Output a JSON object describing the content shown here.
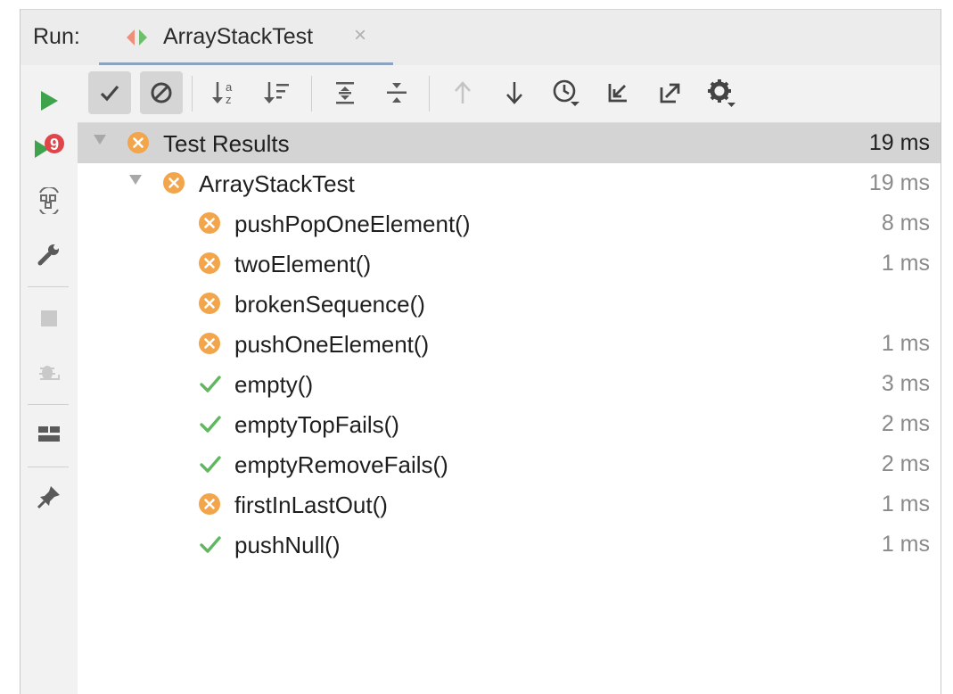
{
  "run": {
    "label": "Run:",
    "tab_title": "ArrayStackTest",
    "tab_close": "×"
  },
  "left_toolbar": [
    {
      "name": "rerun-icon"
    },
    {
      "name": "rerun-failed-icon",
      "badge": "9"
    },
    {
      "name": "toggle-auto-test-icon"
    },
    {
      "name": "edit-configuration-icon"
    },
    {
      "name": "stop-icon"
    },
    {
      "name": "debug-icon"
    },
    {
      "name": "layout-icon"
    },
    {
      "name": "pin-icon"
    }
  ],
  "top_toolbar": [
    {
      "name": "show-passed-icon",
      "active": true
    },
    {
      "name": "show-ignored-icon",
      "active": true
    },
    {
      "name": "sort-alphabetically-icon"
    },
    {
      "name": "sort-by-duration-icon"
    },
    {
      "name": "expand-all-icon"
    },
    {
      "name": "collapse-all-icon"
    },
    {
      "name": "previous-failed-icon",
      "disabled": true
    },
    {
      "name": "next-failed-icon"
    },
    {
      "name": "test-history-icon"
    },
    {
      "name": "import-tests-icon"
    },
    {
      "name": "export-tests-icon"
    },
    {
      "name": "settings-icon"
    }
  ],
  "tree": [
    {
      "label": "Test Results",
      "time": "19 ms",
      "status": "fail",
      "level": 0,
      "expanded": true,
      "selected": true
    },
    {
      "label": "ArrayStackTest",
      "time": "19 ms",
      "status": "fail",
      "level": 1,
      "expanded": true
    },
    {
      "label": "pushPopOneElement()",
      "time": "8 ms",
      "status": "fail",
      "level": 2
    },
    {
      "label": "twoElement()",
      "time": "1 ms",
      "status": "fail",
      "level": 2
    },
    {
      "label": "brokenSequence()",
      "time": "",
      "status": "fail",
      "level": 2
    },
    {
      "label": "pushOneElement()",
      "time": "1 ms",
      "status": "fail",
      "level": 2
    },
    {
      "label": "empty()",
      "time": "3 ms",
      "status": "pass",
      "level": 2
    },
    {
      "label": "emptyTopFails()",
      "time": "2 ms",
      "status": "pass",
      "level": 2
    },
    {
      "label": "emptyRemoveFails()",
      "time": "2 ms",
      "status": "pass",
      "level": 2
    },
    {
      "label": "firstInLastOut()",
      "time": "1 ms",
      "status": "fail",
      "level": 2
    },
    {
      "label": "pushNull()",
      "time": "1 ms",
      "status": "pass",
      "level": 2
    }
  ],
  "colors": {
    "fail": "#f2a54a",
    "pass": "#5fb85f",
    "run_green": "#3fa34d",
    "badge_red": "#e0454a",
    "selection": "#d4d4d4"
  }
}
